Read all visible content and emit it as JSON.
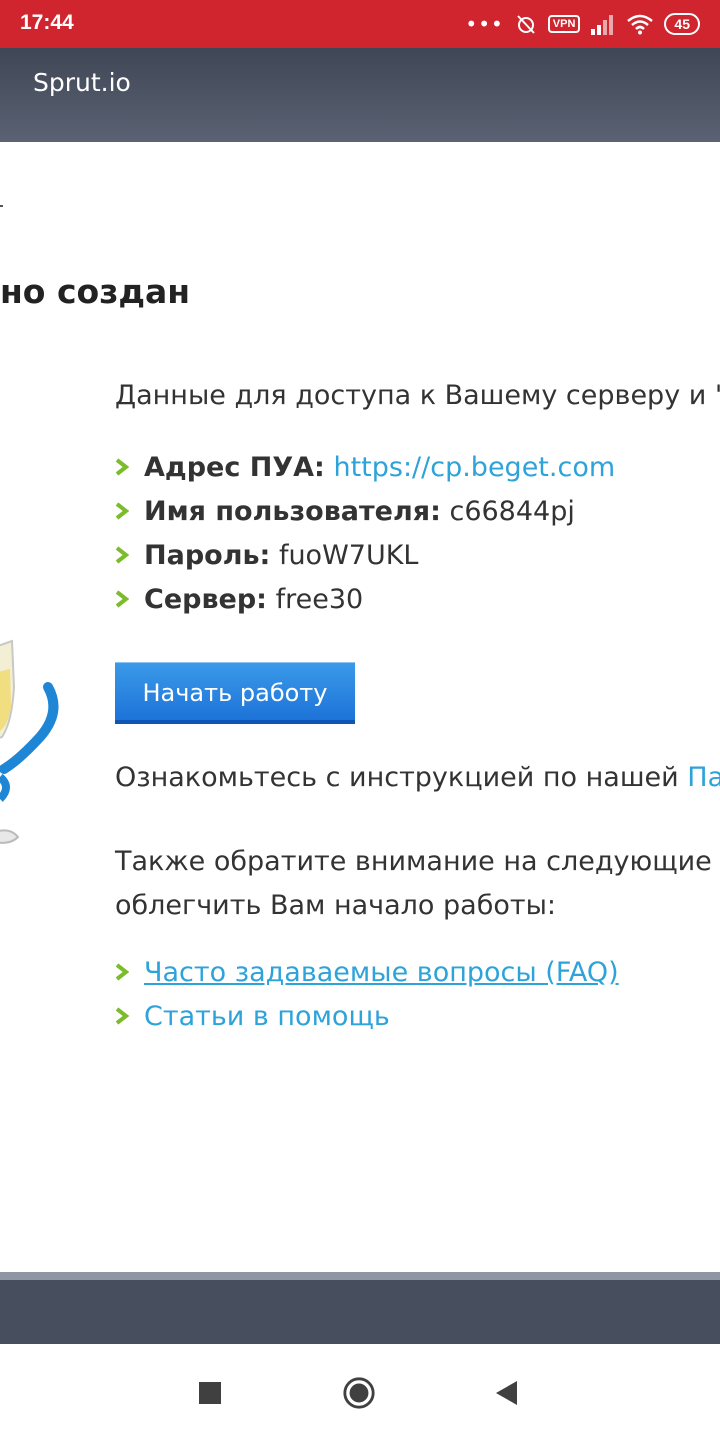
{
  "status_bar": {
    "time": "17:44",
    "vpn": "VPN",
    "battery": "45"
  },
  "app": {
    "title": "Sprut.io"
  },
  "page": {
    "heading": "но создан",
    "intro": "Данные для доступа к Вашему серверу и \"Па",
    "details": [
      {
        "label": "Адрес ПУА:",
        "value": "https://cp.beget.com"
      },
      {
        "label": "Имя пользователя:",
        "value": "c66844pj"
      },
      {
        "label": "Пароль:",
        "value": "fuoW7UKL"
      },
      {
        "label": "Сервер:",
        "value": "free30"
      }
    ],
    "start_button": "Начать работу",
    "instruction_text": "Ознакомьтесь с инструкцией по нашей ",
    "instruction_link": "Панел",
    "also_line1": "Также обратите внимание на следующие раз",
    "also_line2": "облегчить Вам начало работы:",
    "help_links": [
      {
        "label": "Часто задаваемые вопросы (FAQ)"
      },
      {
        "label": "Статьи в помощь"
      }
    ]
  },
  "colors": {
    "status_bar": "#d0252f",
    "app_bar": "#4a5161",
    "link": "#2ea3d9",
    "button": "#1f7ad9",
    "bullet": "#7cbb2c"
  }
}
